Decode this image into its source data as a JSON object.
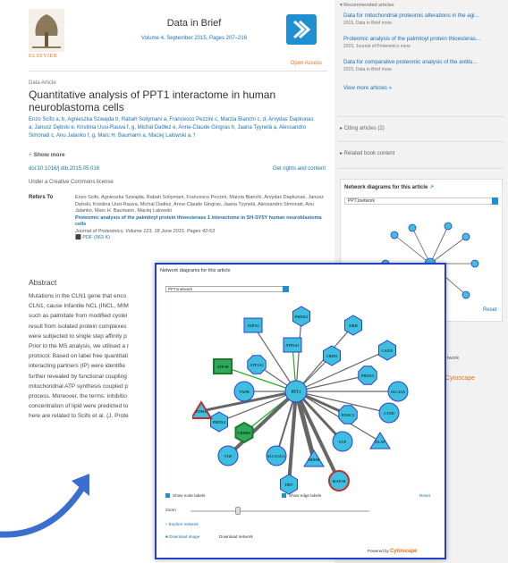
{
  "journal": {
    "name": "Data in Brief",
    "volume": "Volume 4, September 2015, Pages 207–216",
    "publisher": "ELSEVIER",
    "open_access": "Open Access"
  },
  "article": {
    "type": "Data Article",
    "title": "Quantitative analysis of PPT1 interactome in human neuroblastoma cells",
    "authors": "Enzo Scifo a, b, Agnieszka Szwajda b, Rabah Soliymani a, Francesco Pezzini c, Marzia Bianchi c, d, Arvydas Dapkunas a, Janusz Dębski e, Kristiina Uusi-Rauva f, g, Michal Dadlez e, Anne-Claude Gingras h, Jaana Tyynelä a, Alessandro Simonati c, Anu Jalanko f, g, Marc H. Baumann a, Maciej Lalowski a, f",
    "show_more": "Show more",
    "doi": "doi:10.1016/j.dib.2015.05.016",
    "rights": "Get rights and content",
    "license": "Under a Creative Commons license",
    "refers_label": "Refers To",
    "refers_authors": "Enzo Scifo, Agnieszka Szwajda, Rabah Soliymani, Francesco Pezzini, Marzia Bianchi, Arvydas Dapkunas, Janusz Dębski, Kristiina Uusi-Rauva, Michal Dadlez, Anne-Claude Gingras, Jaana Tyynelä, Alessandro Simonati, Anu Jalanko, Marc H. Baumann, Maciej Lalowski",
    "refers_title": "Proteomic analysis of the palmitoyl protein thioesterase 1 interactome in SH-SY5Y human neuroblastoma cells",
    "refers_journal": "Journal of Proteomics, Volume 123, 18 June 2015, Pages 42-53",
    "refers_pdf": "PDF (963 K)",
    "abstract_heading": "Abstract",
    "abstract_lines": [
      "Mutations in the CLN1 gene that enco",
      "CLN1, cause Infantile NCL (INCL, MIM",
      "such as palmitate from modified cystei",
      "result from isolated protein complexes",
      "were subjected to single step affinity p",
      "Prior to the MS analysis, we utilised a r",
      "protocol. Based on label free quantitati",
      "interacting partners (IP) were identifie",
      "further revealed by functional coupling",
      "mitochondrial ATP synthesis coupled p",
      "process. Moreover, the terms: inhibitio",
      "concentration of lipid were predicted to",
      "here are related to Scifo et al. (J. Prote"
    ]
  },
  "sidebar": {
    "recommended_heading": "Recommended articles",
    "recommended": [
      {
        "title": "Data for mitochondrial proteomic alterations in the agi...",
        "meta": "2015, Data in Brief   more"
      },
      {
        "title": "Proteomic analysis of the palmitoyl protein thioesteras...",
        "meta": "2015, Journal of Proteomics   more"
      },
      {
        "title": "Data for comparative proteomic analysis of the antitu...",
        "meta": "2015, Data in Brief   more"
      }
    ],
    "view_more": "View more articles »",
    "citing": "Citing articles (2)",
    "related_book": "Related book content",
    "network_title": "Network diagrams for this article",
    "network_select": "PPT1network",
    "reset": "Reset",
    "network_label": "twork",
    "powered": "Cytoscape"
  },
  "popup": {
    "title": "Network diagrams for this article",
    "select": "PPT1network",
    "show_node_labels": "Show node labels",
    "show_edge_labels": "Show edge labels",
    "reset": "Reset",
    "zoom": "Zoom",
    "explore": "Explore network",
    "download_image": "Download image",
    "download_network": "Download network",
    "powered_by": "Powered by",
    "cytoscape": "Cytoscape",
    "center_node": "PPT1",
    "nodes": [
      "ATP5O",
      "PRDX2",
      "DBH",
      "ATP5A1",
      "CRIP2",
      "CANX",
      "ATP5B",
      "ATP1A1",
      "PRDX5",
      "VAPB",
      "SLC25A",
      "EDAC2",
      "CTSD",
      "PRDX4",
      "CRMP2",
      "VCP",
      "DLAT",
      "VGF",
      "SLC25A11",
      "HDHB",
      "MAP1B",
      "DBT",
      "FDHA"
    ]
  },
  "colors": {
    "accent": "#1f8fd1",
    "node_fill": "#3fbfe0",
    "node_border": "#2e3fd0",
    "highlight_edge": "#22aa22",
    "popup_border": "#2540c8"
  }
}
